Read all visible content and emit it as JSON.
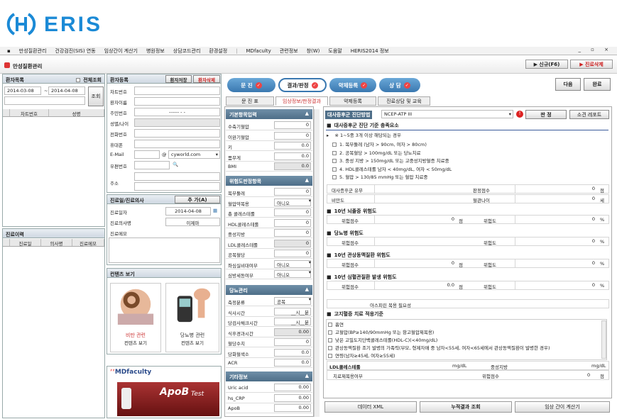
{
  "logo": {
    "text": "ERIS"
  },
  "menu": [
    "만성질환관리",
    "건강검진(SIS) 연동",
    "임상간이 계산기",
    "병원정보",
    "상담코드관리",
    "환경설정",
    "MDfaculty",
    "관련정보",
    "창(W)",
    "도움말",
    "HERIS2014 정보"
  ],
  "window_controls": "_ ▫ ×",
  "title": "만성질환관리",
  "top_buttons": {
    "new": "▶ 신규(F6)",
    "delete": "▶ 진료삭제"
  },
  "patient_list": {
    "header": "환자목록",
    "view_all": "전체조회",
    "date_from": "2014-03-08",
    "date_to": "2014-04-08",
    "search_btn": "조회",
    "columns": [
      "차트번호",
      "성명"
    ]
  },
  "visit_history": {
    "header": "진료이력",
    "columns": [
      "진료일",
      "의사명",
      "진료메모"
    ]
  },
  "patient_reg": {
    "header": "환자등록",
    "save": "환자저장",
    "delete": "환자삭제",
    "fields": [
      "차트번호",
      "환자이름",
      "주민번호",
      "성별/나이",
      "전화번호",
      "휴대폰",
      "E-Mail",
      "우편번호",
      "주소"
    ],
    "ssn_value": "------ - -",
    "email_at": "@",
    "email_domain": "cyworld.com"
  },
  "visit_reg": {
    "header": "진료일/진료의사",
    "add": "추 가(A)",
    "fields": [
      "진료일자",
      "진료의사명",
      "진료메모"
    ],
    "date": "2014-04-08",
    "doctor": "이제마"
  },
  "contents": {
    "header": "컨텐츠 보기",
    "items": [
      {
        "title": "비만 관련",
        "sub": "컨텐츠 보기"
      },
      {
        "title": "당뇨병 관련",
        "sub": "컨텐츠 보기"
      }
    ]
  },
  "ads": {
    "mdfaculty": "MDfaculty",
    "apob": "ApoB",
    "apob_test": "Test"
  },
  "steps": [
    "문 진",
    "결과/판정",
    "약제등록",
    "상 담"
  ],
  "tabs": [
    "문 진 표",
    "임상정보/판정결과",
    "약제등록",
    "진료상담 및 교육"
  ],
  "right_buttons": {
    "next": "다음",
    "done": "완료"
  },
  "basic": {
    "header": "기본항목입력",
    "rows": [
      {
        "k": "수축기혈압",
        "v": "0"
      },
      {
        "k": "이완기혈압",
        "v": "0"
      },
      {
        "k": "키",
        "v": "0.0"
      },
      {
        "k": "몸무게",
        "v": "0.0"
      },
      {
        "k": "BMI",
        "v": "0.0"
      }
    ]
  },
  "risk": {
    "header": "위험도판정항목",
    "rows": [
      {
        "k": "복부둘레",
        "v": "0"
      },
      {
        "k": "혈압약복용",
        "v": "아니오"
      },
      {
        "k": "총 콜레스테롤",
        "v": "0"
      },
      {
        "k": "HDL콜레스테롤",
        "v": "0"
      },
      {
        "k": "중성지방",
        "v": "0"
      },
      {
        "k": "LDL콜레스테롤",
        "v": "0"
      },
      {
        "k": "공복혈당",
        "v": "0"
      },
      {
        "k": "좌심실비대여부",
        "v": "아니오"
      },
      {
        "k": "심방세동여부",
        "v": "아니오"
      }
    ]
  },
  "glucose": {
    "header": "당뇨관리",
    "rows": [
      {
        "k": "측정분류",
        "v": "공복"
      },
      {
        "k": "식사시간",
        "v": "__시__분"
      },
      {
        "k": "당검사채크시간",
        "v": "__시__분"
      },
      {
        "k": "식후경과시간",
        "v": "0.00"
      },
      {
        "k": "혈당수치",
        "v": "0"
      },
      {
        "k": "당화혈색소",
        "v": "0.0"
      },
      {
        "k": "ACR",
        "v": "0.0"
      }
    ]
  },
  "etc": {
    "header": "기타정보",
    "rows": [
      {
        "k": "Uric acid",
        "v": "0.00"
      },
      {
        "k": "hs_CRP",
        "v": "0.00"
      },
      {
        "k": "ApoB",
        "v": "0.00"
      }
    ]
  },
  "diag": {
    "method_label": "대사증후군 진단방법",
    "method_value": "NCEP-ATP III",
    "judge_btn": "판  정",
    "report_btn": "소견 레포트",
    "criteria_header": "대사증후군 진단 기준 충족요소",
    "summary": "※ 1~5중 3개 이상 해당되는 경우",
    "criteria": [
      "1. 복부둘레 (남자 > 90cm, 여자 > 80cm)",
      "2. 공복혈당 > 100mg/dL 또는 당뇨치료",
      "3. 중성 지방 > 150mg/dL 또는 고중성지방혈증 치료중",
      "4. HDL콜레스테롤 남자 < 40mg/dL, 여자 < 50mg/dL",
      "5. 혈압 > 130/85 mmHg 또는 혈압 치료중"
    ],
    "result_rows": [
      {
        "k1": "대사증후군 유무",
        "v1": "",
        "k2": "판정점수",
        "v2": "0",
        "u2": "점"
      },
      {
        "k1": "비만도",
        "v1": "",
        "k2": "혈관나이",
        "v2": "0",
        "u2": "세"
      }
    ]
  },
  "stroke": {
    "header": "10년 뇌졸중 위험도",
    "k1": "위험점수",
    "v1": "0",
    "u1": "점",
    "k2": "위험도",
    "v2": "0",
    "u2": "%"
  },
  "diabetes": {
    "header": "당뇨병 위험도",
    "k1": "위험점수",
    "v1": "",
    "k2": "위험도",
    "v2": "0",
    "u2": "%"
  },
  "cad": {
    "header": "10년 관상동맥질환 위험도",
    "k1": "위험점수",
    "v1": "0",
    "u1": "점",
    "k2": "위험도",
    "v2": "0",
    "u2": "%"
  },
  "cvd": {
    "header": "10년 심혈관질환 발생 위험도",
    "k1": "위험점수",
    "v1": "0.0",
    "u1": "점",
    "k2": "위험도",
    "v2": "0",
    "u2": "%"
  },
  "aspirin": "아스피린 복용 필요성",
  "lipid": {
    "header": "고지혈증 치료 적응기준",
    "items": [
      "흡연",
      "고혈압(BP≥140/90mmHg 또는 항고혈압제복용)",
      "낮은 고밀도지단백콜레스테롤(HDL-C)(<40mg/dL)",
      "관상동맥질환 조기 발병의 가족력(부모, 형제자매 중 남자<55세, 여자<65세에서 관상동맥질환이 발병한 경우)",
      "연령(남자≥45세, 여자≥55세)"
    ],
    "ldl_label": "LDL콜레스테롤",
    "unit": "mg/dL",
    "tg_label": "중성지방",
    "tx_label": "치료제복용여부",
    "score_label": "위험점수",
    "score": "0",
    "score_unit": "점"
  },
  "footer": [
    "데이터 XML",
    "누적결과 조회",
    "임상 간이 계산기"
  ],
  "colors": {
    "brand": "#1b8ad6",
    "accent_red": "#dd3333",
    "section": "#4e6e88"
  }
}
